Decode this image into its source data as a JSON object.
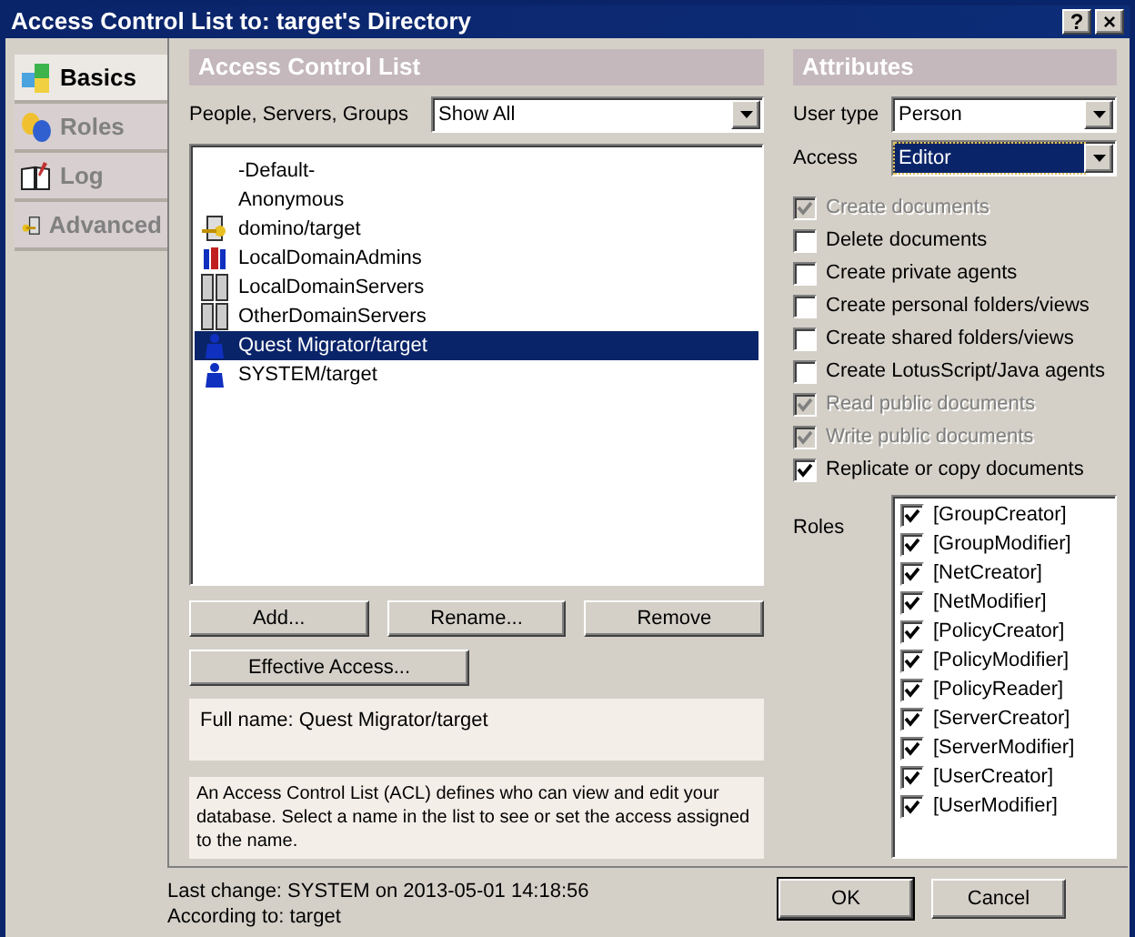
{
  "window": {
    "title": "Access Control List to: target's Directory",
    "buttons": [
      "?",
      "×"
    ]
  },
  "sidebar": {
    "tabs": [
      {
        "label": "Basics",
        "selected": true
      },
      {
        "label": "Roles",
        "selected": false
      },
      {
        "label": "Log",
        "selected": false
      },
      {
        "label": "Advanced",
        "selected": false
      }
    ]
  },
  "acl": {
    "heading": "Access Control List",
    "filter_label": "People, Servers, Groups",
    "filter_value": "Show All",
    "entries": [
      {
        "name": "-Default-",
        "kind": "none",
        "selected": false
      },
      {
        "name": "Anonymous",
        "kind": "none",
        "selected": false
      },
      {
        "name": "domino/target",
        "kind": "server-key",
        "selected": false
      },
      {
        "name": "LocalDomainAdmins",
        "kind": "group",
        "selected": false
      },
      {
        "name": "LocalDomainServers",
        "kind": "server",
        "selected": false
      },
      {
        "name": "OtherDomainServers",
        "kind": "server",
        "selected": false
      },
      {
        "name": "Quest Migrator/target",
        "kind": "person",
        "selected": true
      },
      {
        "name": "SYSTEM/target",
        "kind": "person",
        "selected": false
      }
    ],
    "buttons": [
      "Add...",
      "Rename...",
      "Remove"
    ],
    "effective_access": "Effective Access...",
    "full_name": "Full name: Quest Migrator/target",
    "description": "An Access Control List (ACL) defines who can view and edit your database. Select a name in the list to see or set the access assigned to the name."
  },
  "attributes": {
    "heading": "Attributes",
    "user_type": {
      "label": "User type",
      "value": "Person",
      "focused": false
    },
    "access": {
      "label": "Access",
      "value": "Editor",
      "focused": true
    },
    "options": [
      {
        "label": "Create documents",
        "checked": true,
        "disabled": true
      },
      {
        "label": "Delete documents",
        "checked": false,
        "disabled": false
      },
      {
        "label": "Create private agents",
        "checked": false,
        "disabled": false
      },
      {
        "label": "Create personal folders/views",
        "checked": false,
        "disabled": false
      },
      {
        "label": "Create shared folders/views",
        "checked": false,
        "disabled": false
      },
      {
        "label": "Create LotusScript/Java agents",
        "checked": false,
        "disabled": false
      },
      {
        "label": "Read public documents",
        "checked": true,
        "disabled": true
      },
      {
        "label": "Write public documents",
        "checked": true,
        "disabled": true
      },
      {
        "label": "Replicate or copy documents",
        "checked": true,
        "disabled": false
      }
    ],
    "roles_label": "Roles",
    "roles": [
      {
        "label": "[GroupCreator]",
        "checked": true
      },
      {
        "label": "[GroupModifier]",
        "checked": true
      },
      {
        "label": "[NetCreator]",
        "checked": true
      },
      {
        "label": "[NetModifier]",
        "checked": true
      },
      {
        "label": "[PolicyCreator]",
        "checked": true
      },
      {
        "label": "[PolicyModifier]",
        "checked": true
      },
      {
        "label": "[PolicyReader]",
        "checked": true
      },
      {
        "label": "[ServerCreator]",
        "checked": true
      },
      {
        "label": "[ServerModifier]",
        "checked": true
      },
      {
        "label": "[UserCreator]",
        "checked": true
      },
      {
        "label": "[UserModifier]",
        "checked": true
      }
    ]
  },
  "footer": {
    "last_change": "Last change: SYSTEM on 2013-05-01 14:18:56",
    "according_to": "According to: target",
    "buttons": [
      "OK",
      "Cancel"
    ]
  }
}
